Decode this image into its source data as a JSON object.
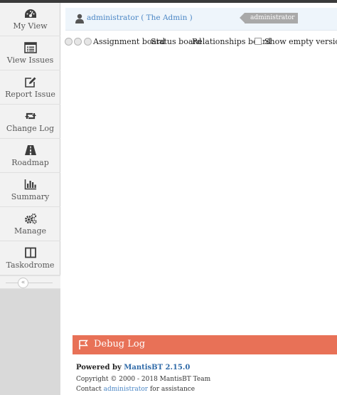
{
  "sidebar": {
    "items": [
      {
        "label": "My View",
        "icon": "dashboard-icon"
      },
      {
        "label": "View Issues",
        "icon": "list-icon"
      },
      {
        "label": "Report Issue",
        "icon": "edit-icon"
      },
      {
        "label": "Change Log",
        "icon": "retweet-icon"
      },
      {
        "label": "Roadmap",
        "icon": "road-icon"
      },
      {
        "label": "Summary",
        "icon": "bar-chart-icon"
      },
      {
        "label": "Manage",
        "icon": "gears-icon"
      },
      {
        "label": "Taskodrome",
        "icon": "columns-icon"
      }
    ],
    "collapse_glyph": "«"
  },
  "breadcrumb": {
    "user_link": "administrator ( The Admin )",
    "role_tag": "administrator"
  },
  "board": {
    "options": [
      "Assignment board",
      "Status board",
      "Relationships board"
    ],
    "show_empty_label": "Show empty versions",
    "show_empty_checked": false
  },
  "debug": {
    "title": "Debug Log"
  },
  "footer": {
    "powered_by": "Powered by",
    "product": "MantisBT 2.15.0",
    "copyright": "Copyright © 2000 - 2018 MantisBT Team",
    "contact_prefix": "Contact",
    "contact_link": "administrator",
    "contact_suffix": "for assistance"
  },
  "colors": {
    "accent": "#e87157",
    "link": "#4a86c5",
    "breadcrumb_bg": "#eef5fb",
    "sidebar_bg": "#f2f2f2"
  }
}
